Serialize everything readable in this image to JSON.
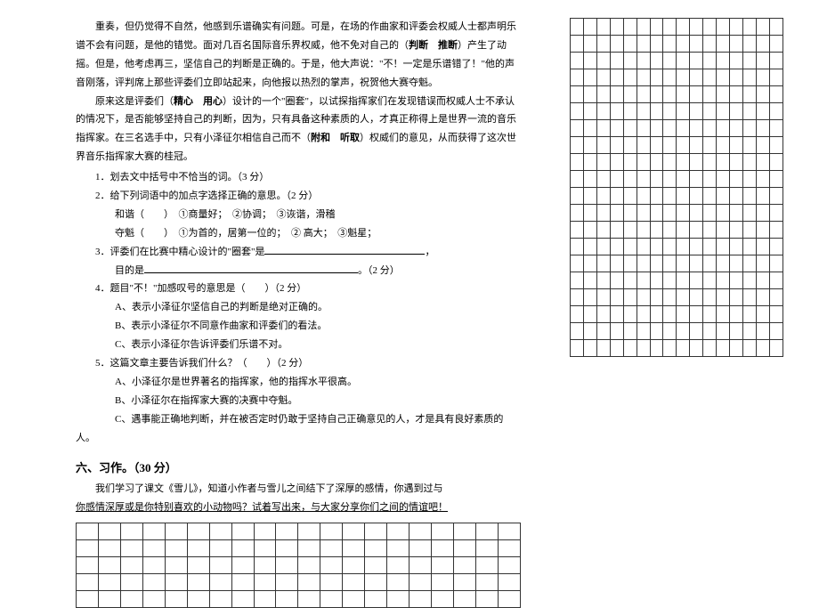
{
  "passage": {
    "p1_prefix": "重奏，但仍觉得不自然，他感到乐谱确实有问题。可是，在场的作曲家和评委会权威人士都声明乐谱不会有问题，是他的错觉。面对几百名国际音乐界权威，他不免对自己的（",
    "p1_bold": "判断　推断",
    "p1_suffix": "）产生了动摇。但是，他考虑再三，坚信自己的判断是正确的。于是，他大声说：\"不！一定是乐谱错了！\"他的声音刚落，评判席上那些评委们立即站起来，向他报以热烈的掌声，祝贺他大赛夺魁。",
    "p2_prefix1": "原来这是评委们（",
    "p2_bold1": "精心　用心",
    "p2_mid": "）设计的一个\"圈套\"，以试探指挥家们在发现错误而权威人士不承认的情况下，是否能够坚持自己的判断，因为，只有具备这种素质的人，才真正称得上是世界一流的音乐指挥家。在三名选手中，只有小泽征尔相信自己而不（",
    "p2_bold2": "附和　听取",
    "p2_suffix": "）权威们的意见，从而获得了这次世界音乐指挥家大赛的桂冠。"
  },
  "questions": {
    "q1": "1．划去文中括号中不恰当的词。（3 分）",
    "q2": "2．给下列词语中的加点字选择正确的意思。（2 分）",
    "q2a": "和谐（　　）　①商量好；　②协调；　③诙谐，滑稽",
    "q2b": "夺魁（　　）　①为首的，居第一位的；　② 高大；　③魁星；",
    "q3_prefix": "3．评委们在比赛中精心设计的\"圈套\"是",
    "q3_tail": "，",
    "q3b_prefix": "目的是",
    "q3b_tail": "。（2 分）",
    "q4": "4．题目\"不！\"加感叹号的意思是（　　）（2 分）",
    "q4a": "A、表示小泽征尔坚信自己的判断是绝对正确的。",
    "q4b": "B、表示小泽征尔不同意作曲家和评委们的看法。",
    "q4c": "C、表示小泽征尔告诉评委们乐谱不对。",
    "q5": "5．这篇文章主要告诉我们什么？（　　）（2 分）",
    "q5a": "A、小泽征尔是世界著名的指挥家，他的指挥水平很高。",
    "q5b": "B、小泽征尔在指挥家大赛的决赛中夺魁。",
    "q5c": "C、遇事能正确地判断，并在被否定时仍敢于坚持自己正确意见的人，才是具有良好素质的人。"
  },
  "section6": {
    "heading": "六、习作。（30 分）",
    "prompt1": "我们学习了课文《雪儿》，知道小作者与雪儿之间结下了深厚的感情，你遇到过与",
    "prompt2": "你感情深厚或是你特别喜欢的小动物吗？试着写出来，与大家分享你们之间的情谊吧！"
  },
  "grid_right": {
    "rows": 20,
    "cols": 16
  },
  "grid_bottom": {
    "rows": 5,
    "cols": 20
  }
}
